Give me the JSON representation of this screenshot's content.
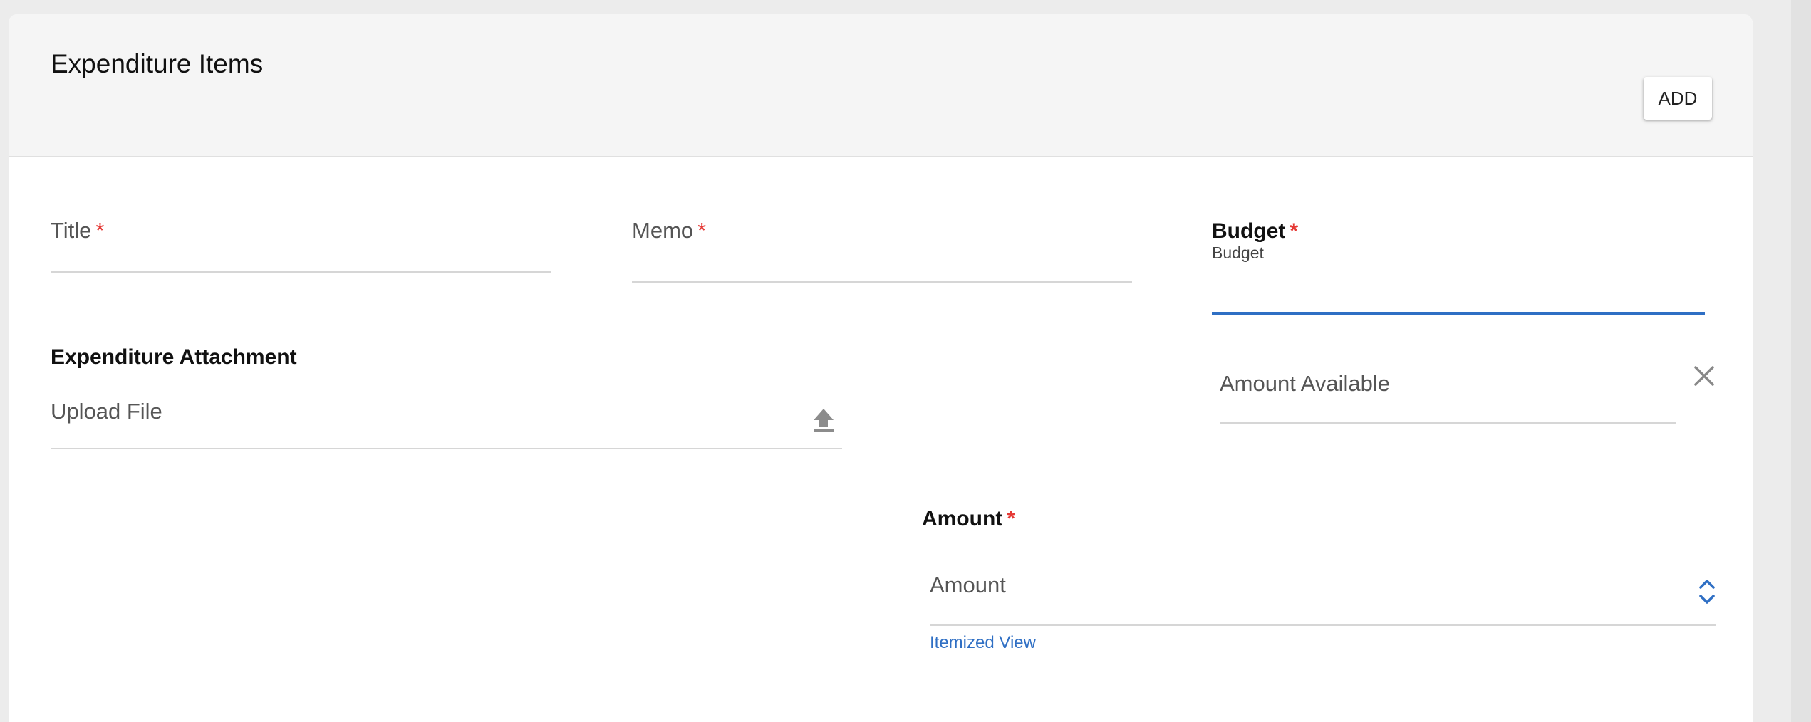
{
  "section": {
    "title": "Expenditure Items",
    "add_label": "ADD"
  },
  "form": {
    "title_field": {
      "label": "Title",
      "required_mark": "*",
      "value": ""
    },
    "memo_field": {
      "label": "Memo",
      "required_mark": "*",
      "value": ""
    },
    "budget_field": {
      "label": "Budget",
      "required_mark": "*",
      "sublabel": "Budget",
      "value": ""
    },
    "attachment": {
      "label": "Expenditure Attachment",
      "placeholder": "Upload File"
    },
    "amount_available": {
      "placeholder": "Amount Available"
    },
    "amount": {
      "label": "Amount",
      "required_mark": "*",
      "placeholder": "Amount",
      "link": "Itemized View"
    }
  },
  "colors": {
    "accent": "#2f6fc4",
    "required": "#e53935",
    "header_bg": "#f5f5f5"
  },
  "icons": {
    "upload": "upload-icon",
    "clear": "close-icon",
    "stepper": "chevron-up-down-icon"
  }
}
